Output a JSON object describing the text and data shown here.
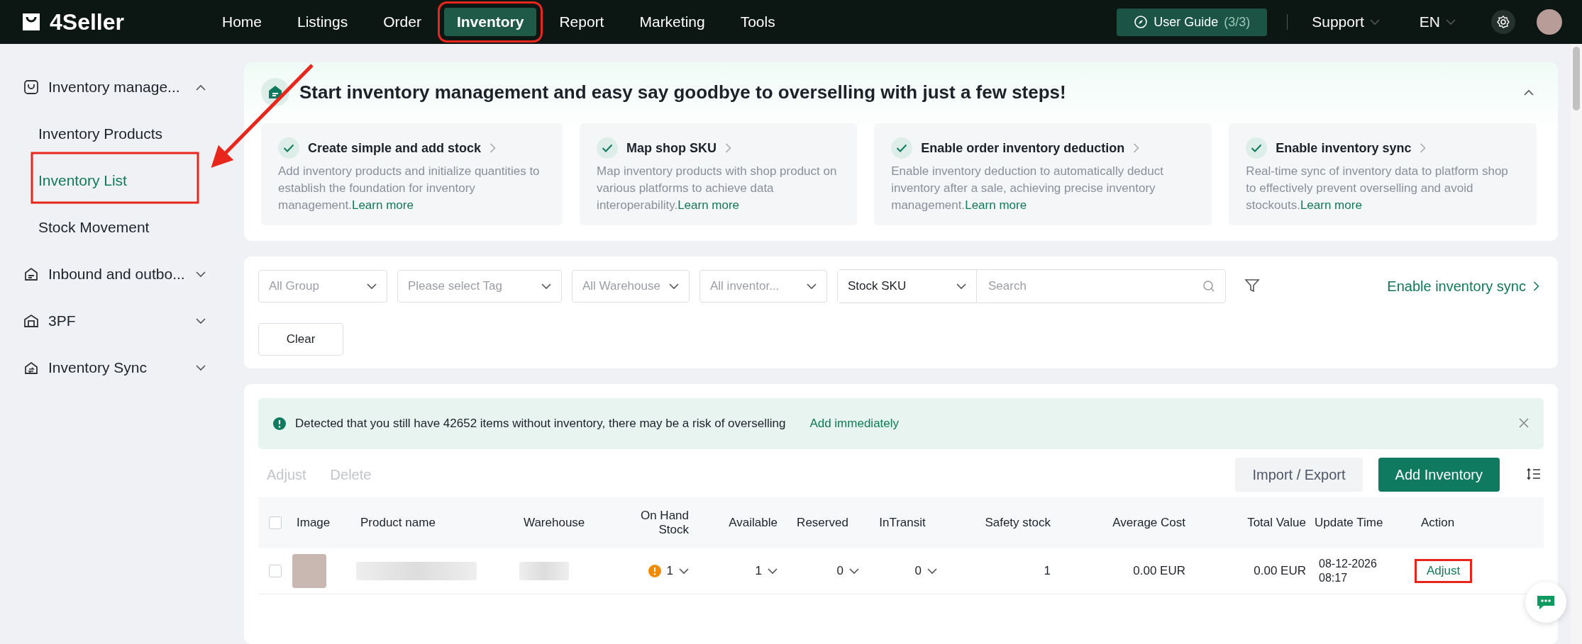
{
  "top_nav": {
    "logo": "4Seller",
    "items": [
      {
        "label": "Home",
        "selected": false
      },
      {
        "label": "Listings",
        "selected": false
      },
      {
        "label": "Order",
        "selected": false
      },
      {
        "label": "Inventory",
        "selected": true
      },
      {
        "label": "Report",
        "selected": false
      },
      {
        "label": "Marketing",
        "selected": false
      },
      {
        "label": "Tools",
        "selected": false
      }
    ],
    "user_guide": {
      "label": "User Guide",
      "progress": "(3/3)"
    },
    "support": "Support",
    "language": "EN"
  },
  "sidebar": {
    "items": [
      {
        "label": "Inventory manage...",
        "expanded": true,
        "children": [
          {
            "label": "Inventory Products",
            "selected": false
          },
          {
            "label": "Inventory List",
            "selected": true
          },
          {
            "label": "Stock Movement",
            "selected": false
          }
        ]
      },
      {
        "label": "Inbound and outbo...",
        "expanded": false
      },
      {
        "label": "3PF",
        "expanded": false
      },
      {
        "label": "Inventory Sync",
        "expanded": false
      }
    ]
  },
  "guide": {
    "title": "Start inventory management and easy say goodbye to overselling with just a few steps!",
    "expanded": true,
    "steps": [
      {
        "title": "Create simple and add stock",
        "description": "Add inventory products and initialize quantities to establish the foundation for inventory management.",
        "link": "Learn more",
        "done": true
      },
      {
        "title": "Map shop SKU",
        "description": "Map inventory products with shop product on various platforms to achieve data interoperability.",
        "link": "Learn more",
        "done": true
      },
      {
        "title": "Enable order inventory deduction",
        "description": "Enable inventory deduction to automatically deduct inventory after a sale, achieving precise inventory management.",
        "link": "Learn more",
        "done": true
      },
      {
        "title": "Enable inventory sync",
        "description": "Real-time sync of inventory data to platform shop to effectively prevent overselling and avoid stockouts.",
        "link": "Learn more",
        "done": true
      }
    ]
  },
  "filters": {
    "selects": [
      {
        "placeholder": "All Group"
      },
      {
        "placeholder": "Please select Tag"
      },
      {
        "placeholder": "All Warehouse"
      },
      {
        "placeholder": "All inventor..."
      }
    ],
    "search_type": "Stock SKU",
    "search": {
      "placeholder": "Search"
    },
    "sync_link": "Enable inventory sync",
    "clear": "Clear"
  },
  "alert": {
    "message": "Detected that you still have 42652 items without inventory, there may be a risk of overselling",
    "action": "Add immediately"
  },
  "actions": {
    "bulk": [
      {
        "label": "Adjust",
        "disabled": true
      },
      {
        "label": "Delete",
        "disabled": true
      }
    ],
    "import_export": "Import / Export",
    "add": "Add Inventory"
  },
  "table": {
    "all_checked": false,
    "columns": [
      "Image",
      "Product name",
      "Warehouse",
      "On Hand Stock",
      "Available",
      "Reserved",
      "InTransit",
      "Safety stock",
      "Average Cost",
      "Total Value",
      "Update Time",
      "Action"
    ],
    "rows": [
      {
        "checked": false,
        "on_hand": "1",
        "on_hand_warning": true,
        "available": "1",
        "reserved": "0",
        "in_transit": "0",
        "safety_stock": "1",
        "average_cost": "0.00 EUR",
        "total_value": "0.00 EUR",
        "update_time": "08-12-2026 08:17",
        "action": "Adjust"
      }
    ]
  }
}
